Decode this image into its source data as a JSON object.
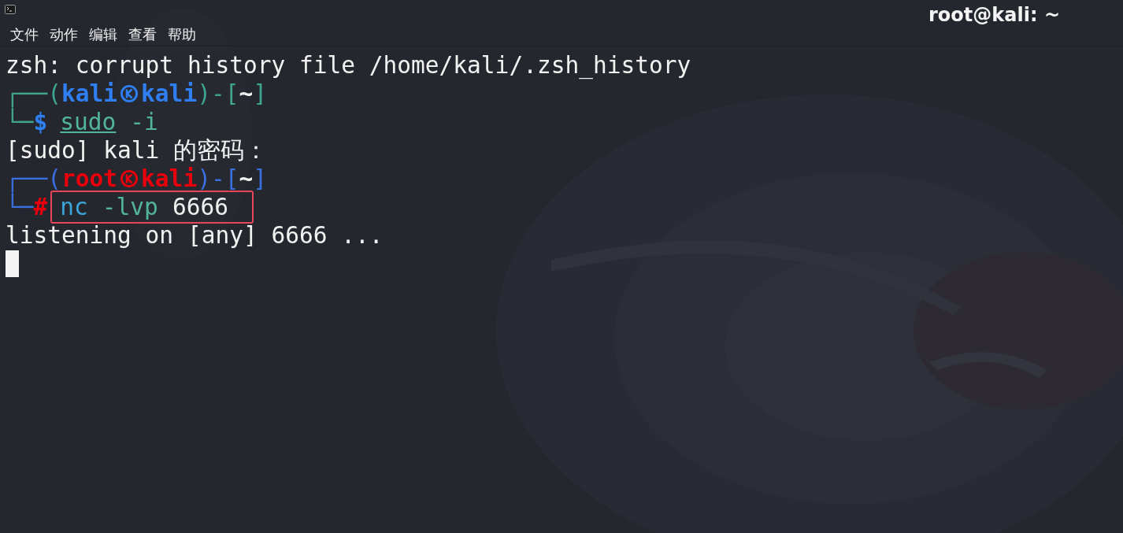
{
  "window": {
    "title": "root@kali: ~"
  },
  "menu": [
    "文件",
    "动作",
    "编辑",
    "查看",
    "帮助"
  ],
  "lines": [
    {
      "kind": "text",
      "text": "zsh: corrupt history file /home/kali/.zsh_history"
    },
    {
      "kind": "user_prompt",
      "open": "┌──(",
      "user": "kali",
      "host": "kali",
      "mid": ")-[",
      "dir": "~",
      "close": "]",
      "corner": "└─",
      "symbol": "$",
      "highlighted": false,
      "tokens": [
        {
          "kind": "precommand",
          "text": "sudo"
        },
        {
          "kind": "option",
          "text": "-i"
        }
      ]
    },
    {
      "kind": "text",
      "text": "[sudo] kali 的密码："
    },
    {
      "kind": "root_prompt",
      "open": "┌──(",
      "user": "root",
      "host": "kali",
      "mid": ")-[",
      "dir": "~",
      "close": "]",
      "corner": "└─",
      "symbol": "#",
      "highlighted": true,
      "tokens": [
        {
          "kind": "command",
          "text": "nc"
        },
        {
          "kind": "option",
          "text": "-lvp"
        },
        {
          "kind": "argument",
          "text": "6666"
        }
      ]
    },
    {
      "kind": "text",
      "text": "listening on [any] 6666 ..."
    },
    {
      "kind": "cursor"
    }
  ]
}
